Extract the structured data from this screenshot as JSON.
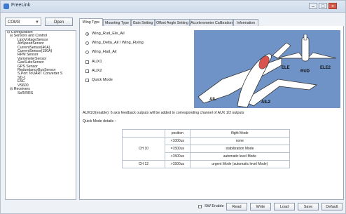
{
  "window": {
    "title": "FreeLink",
    "min": "–",
    "max": "□",
    "close": "×"
  },
  "left": {
    "port_value": "COM3",
    "open_label": "Open",
    "tree": [
      {
        "label": "⊟ Configuration",
        "level": 0
      },
      {
        "label": "⊟ Sensors and Control",
        "level": 1
      },
      {
        "label": "LipoVoltageSensor",
        "level": 2
      },
      {
        "label": "AirSpeedSensor",
        "level": 2
      },
      {
        "label": "CurrentSensor(40A)",
        "level": 2
      },
      {
        "label": "CurrentSensor(150A)",
        "level": 2
      },
      {
        "label": "RPM Sensor",
        "level": 2
      },
      {
        "label": "VariometerSensor",
        "level": 2
      },
      {
        "label": "GasSuiteSensor",
        "level": 2
      },
      {
        "label": "GPS Sensor",
        "level": 2
      },
      {
        "label": "RedundancyBusSensor",
        "level": 2
      },
      {
        "label": "S.Port ToUART Converter S",
        "level": 2
      },
      {
        "label": "SD-1",
        "level": 2
      },
      {
        "label": "ESC",
        "level": 2
      },
      {
        "label": "VS600",
        "level": 2
      },
      {
        "label": "⊟ Receivers",
        "level": 1
      },
      {
        "label": "SxR/RRS",
        "level": 2
      }
    ]
  },
  "tabs": [
    "Wing Type",
    "Mounting Type",
    "Gain Setting",
    "Offset Angle Setting",
    "Accelerometer Calibration",
    "Information"
  ],
  "options": [
    {
      "label": "Wing_Rud_Ele_Ail",
      "type": "radio",
      "on": true
    },
    {
      "label": "Wing_Delta_Ail / Wing_Flying",
      "type": "radio",
      "on": false
    },
    {
      "label": "Wing_Had_Ail",
      "type": "radio",
      "on": false
    },
    {
      "label": "AUX1",
      "type": "check",
      "on": false
    },
    {
      "label": "AUX2",
      "type": "check",
      "on": false
    },
    {
      "label": "Quick Mode",
      "type": "check",
      "on": false
    }
  ],
  "diagram_labels": {
    "ele": "ELE",
    "rud": "RUD",
    "ele2": "ELE2",
    "ail": "AIL",
    "ail2": "AIL2"
  },
  "note": "AUX1/2(enable): 6 axis feedback outputs will be added to corresponding channel of AUX 1/2 outputs",
  "quick_mode_title": "Quick Mode details :",
  "table": {
    "headers": [
      "position",
      "flight Mode"
    ],
    "rows": [
      {
        "ch": "CH 10",
        "pos": "<1000us",
        "mode": "none"
      },
      {
        "ch": "",
        "pos": "=1500us",
        "mode": "stabilization Mode"
      },
      {
        "ch": "",
        "pos": ">1500us",
        "mode": "automatic level Mode"
      },
      {
        "ch": "CH 12",
        "pos": ">1500us",
        "mode": "urgent Mode (automatic level Mode)"
      }
    ]
  },
  "bottom": {
    "sw_enable": "SW Enable",
    "read": "Read",
    "write": "Write",
    "load": "Load",
    "save": "Save",
    "default": "Default"
  },
  "colors": {
    "diagram_bg": "#6f93c6"
  }
}
